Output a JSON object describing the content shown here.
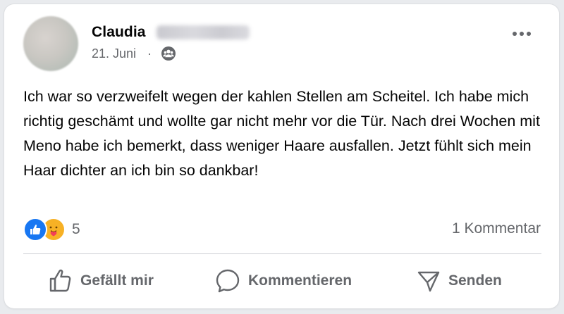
{
  "post": {
    "author_first_name": "Claudia",
    "date": "21. Juni",
    "date_separator": "·",
    "audience_icon": "friends-icon",
    "more_icon": "more-options-icon",
    "text": "Ich war so verzweifelt wegen der kahlen Stellen am Scheitel. Ich habe mich richtig geschämt und wollte gar nicht mehr vor die Tür. Nach drei Wochen mit Meno habe ich bemerkt, dass weniger Haare ausfallen. Jetzt fühlt sich mein Haar dichter an ich bin so dankbar!"
  },
  "reactions": {
    "types": [
      "like-icon",
      "care-icon"
    ],
    "count": "5",
    "comments": "1 Kommentar"
  },
  "actions": {
    "like_label": "Gefällt mir",
    "comment_label": "Kommentieren",
    "send_label": "Senden"
  },
  "colors": {
    "like_blue": "#1877f2",
    "care_yellow": "#f7b125",
    "text_secondary": "#65676b",
    "text_primary": "#050505"
  }
}
